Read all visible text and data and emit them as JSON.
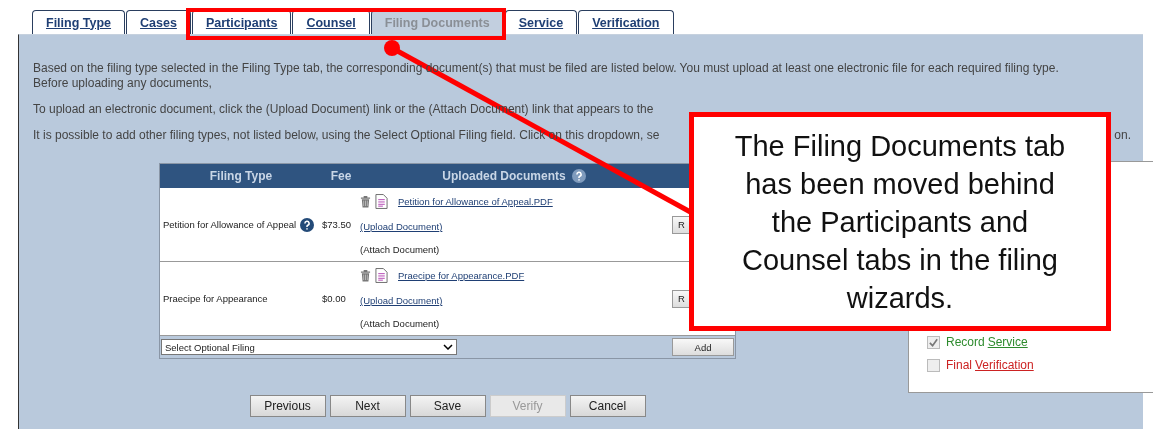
{
  "tabs": [
    {
      "label": "Filing Type",
      "selected": false
    },
    {
      "label": "Cases",
      "selected": false
    },
    {
      "label": "Participants",
      "selected": false
    },
    {
      "label": "Counsel",
      "selected": false
    },
    {
      "label": "Filing Documents",
      "selected": true
    },
    {
      "label": "Service",
      "selected": false
    },
    {
      "label": "Verification",
      "selected": false
    }
  ],
  "instructions": [
    {
      "text": "Based on the filing type selected in the Filing Type tab, the corresponding document(s) that must be filed are listed below. You must upload at least one electronic file for each required filing type. Before uploading any documents,"
    },
    {
      "text": "To upload an electronic document, click the (Upload Document) link or the (Attach Document) link that appears to the"
    },
    {
      "text": "It is possible to add other filing types, not listed below, using the Select Optional Filing field. Click on this dropdown, se",
      "tail": "on."
    }
  ],
  "filings": {
    "columns": [
      "Filing Type",
      "Fee",
      "Uploaded Documents"
    ],
    "rows": [
      {
        "filing_type": "Petition for Allowance of Appeal",
        "has_help": true,
        "fee": "$73.50",
        "file": "Petition for Allowance of Appeal.PDF",
        "upload_link": "(Upload Document)",
        "attach_text": "(Attach Document)",
        "action": "R"
      },
      {
        "filing_type": "Praecipe for Appearance",
        "has_help": false,
        "fee": "$0.00",
        "file": "Praecipe for Appearance.PDF",
        "upload_link": "(Upload Document)",
        "attach_text": "(Attach Document)",
        "action": "R"
      }
    ],
    "optional_select": "Select Optional Filing",
    "add_button": "Add"
  },
  "checklist": [
    {
      "label": "Record",
      "link": "Service",
      "checked": true,
      "color": "#2e8b2e"
    },
    {
      "label": "Final",
      "link": "Verification",
      "checked": false,
      "color": "#cc2222"
    }
  ],
  "buttons": [
    {
      "label": "Previous",
      "disabled": false
    },
    {
      "label": "Next",
      "disabled": false
    },
    {
      "label": "Save",
      "disabled": false
    },
    {
      "label": "Verify",
      "disabled": true
    },
    {
      "label": "Cancel",
      "disabled": false
    }
  ],
  "callout": {
    "text": "The Filing Documents tab has been moved behind the Participants and Counsel tabs in the filing wizards."
  }
}
